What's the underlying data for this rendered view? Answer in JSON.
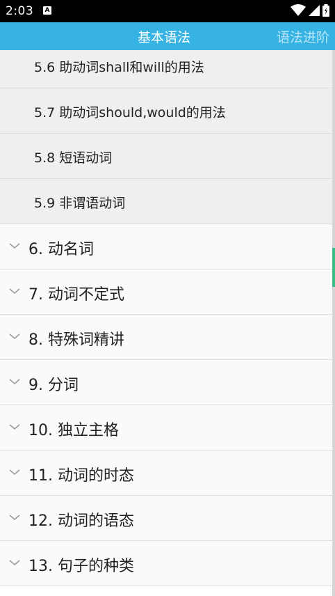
{
  "status_bar": {
    "time": "2:03",
    "notification_icon": "a-notification-icon",
    "icons": [
      "wifi-icon",
      "cell-signal-icon",
      "battery-icon"
    ]
  },
  "tabs": {
    "active": "基本语法",
    "next": "语法进阶"
  },
  "list": {
    "sub_items": [
      {
        "label": "5.6 助动词shall和will的用法"
      },
      {
        "label": "5.7 助动词should,would的用法"
      },
      {
        "label": "5.8 短语动词"
      },
      {
        "label": "5.9 非谓语动词"
      }
    ],
    "groups": [
      {
        "label": "6. 动名词"
      },
      {
        "label": "7. 动词不定式"
      },
      {
        "label": "8. 特殊词精讲"
      },
      {
        "label": "9. 分词"
      },
      {
        "label": "10. 独立主格"
      },
      {
        "label": "11. 动词的时态"
      },
      {
        "label": "12. 动词的语态"
      },
      {
        "label": "13. 句子的种类"
      }
    ]
  },
  "colors": {
    "tab_bar": "#36b3e3",
    "tab_active_text": "#ffffff",
    "tab_inactive_text": "#b9e6f7",
    "sub_row_bg": "#efefef",
    "group_row_bg": "#fafafa",
    "divider": "#dedede",
    "edge_accent": "#3bbf86"
  }
}
